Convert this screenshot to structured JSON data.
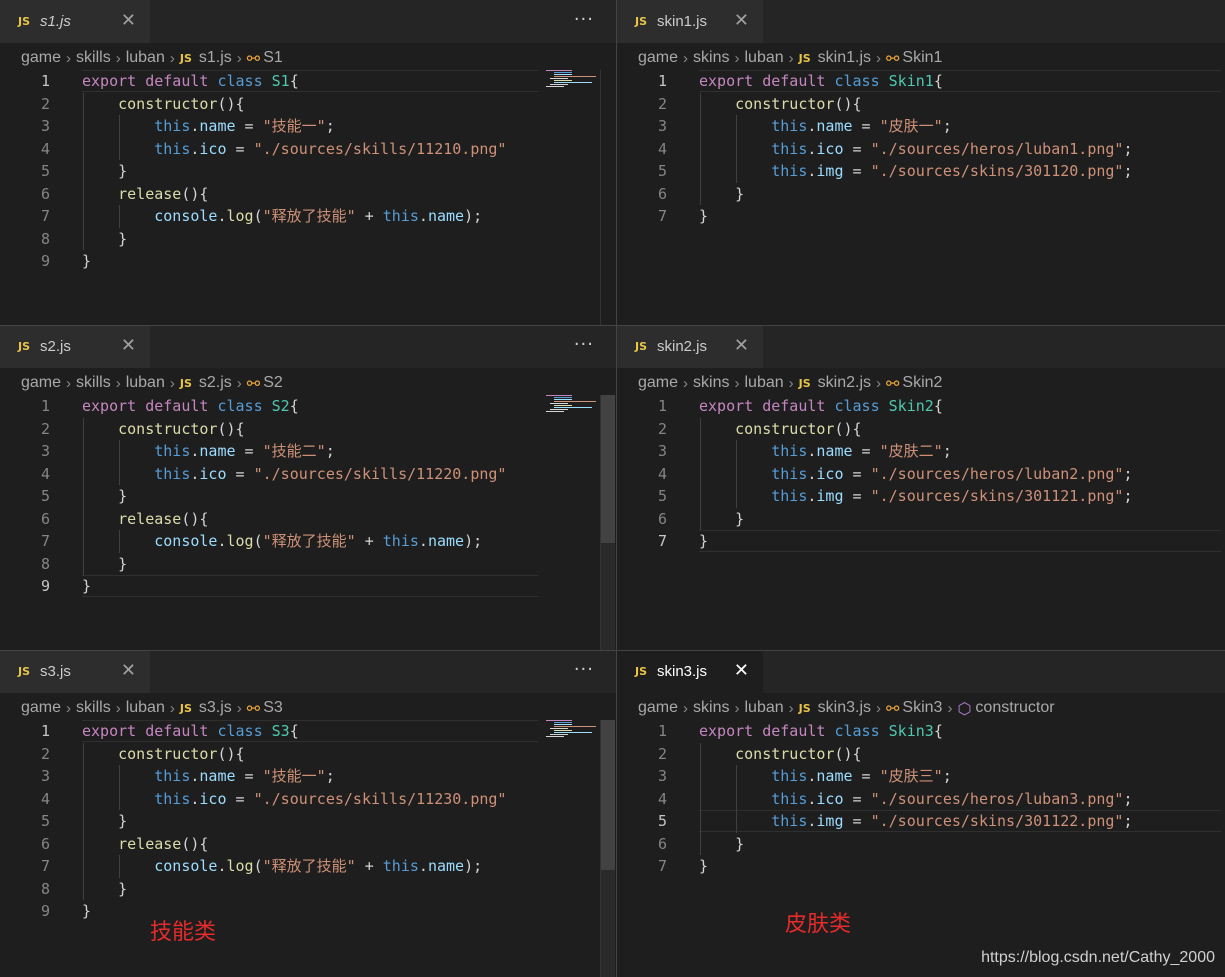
{
  "panes": [
    {
      "id": "s1",
      "tab": {
        "icon": "js-icon",
        "label": "s1.js",
        "italic": true,
        "active": false
      },
      "show_more": true,
      "breadcrumbs": [
        "game",
        "skills",
        "luban",
        "s1.js",
        "S1"
      ],
      "symbol_icon": "class-symbol-icon",
      "current_line": 1,
      "lines": [
        [
          [
            "kw2",
            "export"
          ],
          [
            "pl",
            " "
          ],
          [
            "kw2",
            "default"
          ],
          [
            "pl",
            " "
          ],
          [
            "kw",
            "class"
          ],
          [
            "pl",
            " "
          ],
          [
            "cls",
            "S1"
          ],
          [
            "pl",
            "{"
          ]
        ],
        [
          [
            "pl",
            "    "
          ],
          [
            "fn",
            "constructor"
          ],
          [
            "pl",
            "(){"
          ]
        ],
        [
          [
            "pl",
            "        "
          ],
          [
            "this",
            "this"
          ],
          [
            "pl",
            "."
          ],
          [
            "prop",
            "name"
          ],
          [
            "pl",
            " = "
          ],
          [
            "str",
            "\"技能一\""
          ],
          [
            "pl",
            ";"
          ]
        ],
        [
          [
            "pl",
            "        "
          ],
          [
            "this",
            "this"
          ],
          [
            "pl",
            "."
          ],
          [
            "prop",
            "ico"
          ],
          [
            "pl",
            " = "
          ],
          [
            "str",
            "\"./sources/skills/11210.png\""
          ]
        ],
        [
          [
            "pl",
            "    }"
          ]
        ],
        [
          [
            "pl",
            "    "
          ],
          [
            "fn",
            "release"
          ],
          [
            "pl",
            "(){"
          ]
        ],
        [
          [
            "pl",
            "        "
          ],
          [
            "prop",
            "console"
          ],
          [
            "pl",
            "."
          ],
          [
            "fn",
            "log"
          ],
          [
            "pl",
            "("
          ],
          [
            "str",
            "\"释放了技能\""
          ],
          [
            "pl",
            " + "
          ],
          [
            "this",
            "this"
          ],
          [
            "pl",
            "."
          ],
          [
            "prop",
            "name"
          ],
          [
            "pl",
            ");"
          ]
        ],
        [
          [
            "pl",
            "    }"
          ]
        ],
        [
          [
            "pl",
            "}"
          ]
        ]
      ]
    },
    {
      "id": "skin1",
      "tab": {
        "icon": "js-icon",
        "label": "skin1.js",
        "italic": false,
        "active": false
      },
      "show_more": false,
      "breadcrumbs": [
        "game",
        "skins",
        "luban",
        "skin1.js",
        "Skin1"
      ],
      "symbol_icon": "class-symbol-icon",
      "current_line": 1,
      "lines": [
        [
          [
            "kw2",
            "export"
          ],
          [
            "pl",
            " "
          ],
          [
            "kw2",
            "default"
          ],
          [
            "pl",
            " "
          ],
          [
            "kw",
            "class"
          ],
          [
            "pl",
            " "
          ],
          [
            "cls",
            "Skin1"
          ],
          [
            "pl",
            "{"
          ]
        ],
        [
          [
            "pl",
            "    "
          ],
          [
            "fn",
            "constructor"
          ],
          [
            "pl",
            "(){"
          ]
        ],
        [
          [
            "pl",
            "        "
          ],
          [
            "this",
            "this"
          ],
          [
            "pl",
            "."
          ],
          [
            "prop",
            "name"
          ],
          [
            "pl",
            " = "
          ],
          [
            "str",
            "\"皮肤一\""
          ],
          [
            "pl",
            ";"
          ]
        ],
        [
          [
            "pl",
            "        "
          ],
          [
            "this",
            "this"
          ],
          [
            "pl",
            "."
          ],
          [
            "prop",
            "ico"
          ],
          [
            "pl",
            " = "
          ],
          [
            "str",
            "\"./sources/heros/luban1.png\""
          ],
          [
            "pl",
            ";"
          ]
        ],
        [
          [
            "pl",
            "        "
          ],
          [
            "this",
            "this"
          ],
          [
            "pl",
            "."
          ],
          [
            "prop",
            "img"
          ],
          [
            "pl",
            " = "
          ],
          [
            "str",
            "\"./sources/skins/301120.png\""
          ],
          [
            "pl",
            ";"
          ]
        ],
        [
          [
            "pl",
            "    }"
          ]
        ],
        [
          [
            "pl",
            "}"
          ]
        ]
      ]
    },
    {
      "id": "s2",
      "tab": {
        "icon": "js-icon",
        "label": "s2.js",
        "italic": false,
        "active": false
      },
      "show_more": true,
      "breadcrumbs": [
        "game",
        "skills",
        "luban",
        "s2.js",
        "S2"
      ],
      "symbol_icon": "class-symbol-icon",
      "current_line": 9,
      "lines": [
        [
          [
            "kw2",
            "export"
          ],
          [
            "pl",
            " "
          ],
          [
            "kw2",
            "default"
          ],
          [
            "pl",
            " "
          ],
          [
            "kw",
            "class"
          ],
          [
            "pl",
            " "
          ],
          [
            "cls",
            "S2"
          ],
          [
            "pl",
            "{"
          ]
        ],
        [
          [
            "pl",
            "    "
          ],
          [
            "fn",
            "constructor"
          ],
          [
            "pl",
            "(){"
          ]
        ],
        [
          [
            "pl",
            "        "
          ],
          [
            "this",
            "this"
          ],
          [
            "pl",
            "."
          ],
          [
            "prop",
            "name"
          ],
          [
            "pl",
            " = "
          ],
          [
            "str",
            "\"技能二\""
          ],
          [
            "pl",
            ";"
          ]
        ],
        [
          [
            "pl",
            "        "
          ],
          [
            "this",
            "this"
          ],
          [
            "pl",
            "."
          ],
          [
            "prop",
            "ico"
          ],
          [
            "pl",
            " = "
          ],
          [
            "str",
            "\"./sources/skills/11220.png\""
          ]
        ],
        [
          [
            "pl",
            "    }"
          ]
        ],
        [
          [
            "pl",
            "    "
          ],
          [
            "fn",
            "release"
          ],
          [
            "pl",
            "(){"
          ]
        ],
        [
          [
            "pl",
            "        "
          ],
          [
            "prop",
            "console"
          ],
          [
            "pl",
            "."
          ],
          [
            "fn",
            "log"
          ],
          [
            "pl",
            "("
          ],
          [
            "str",
            "\"释放了技能\""
          ],
          [
            "pl",
            " + "
          ],
          [
            "this",
            "this"
          ],
          [
            "pl",
            "."
          ],
          [
            "prop",
            "name"
          ],
          [
            "pl",
            ");"
          ]
        ],
        [
          [
            "pl",
            "    }"
          ]
        ],
        [
          [
            "pl",
            "}"
          ]
        ]
      ]
    },
    {
      "id": "skin2",
      "tab": {
        "icon": "js-icon",
        "label": "skin2.js",
        "italic": false,
        "active": false
      },
      "show_more": false,
      "breadcrumbs": [
        "game",
        "skins",
        "luban",
        "skin2.js",
        "Skin2"
      ],
      "symbol_icon": "class-symbol-icon",
      "current_line": 7,
      "lines": [
        [
          [
            "kw2",
            "export"
          ],
          [
            "pl",
            " "
          ],
          [
            "kw2",
            "default"
          ],
          [
            "pl",
            " "
          ],
          [
            "kw",
            "class"
          ],
          [
            "pl",
            " "
          ],
          [
            "cls",
            "Skin2"
          ],
          [
            "pl",
            "{"
          ]
        ],
        [
          [
            "pl",
            "    "
          ],
          [
            "fn",
            "constructor"
          ],
          [
            "pl",
            "(){"
          ]
        ],
        [
          [
            "pl",
            "        "
          ],
          [
            "this",
            "this"
          ],
          [
            "pl",
            "."
          ],
          [
            "prop",
            "name"
          ],
          [
            "pl",
            " = "
          ],
          [
            "str",
            "\"皮肤二\""
          ],
          [
            "pl",
            ";"
          ]
        ],
        [
          [
            "pl",
            "        "
          ],
          [
            "this",
            "this"
          ],
          [
            "pl",
            "."
          ],
          [
            "prop",
            "ico"
          ],
          [
            "pl",
            " = "
          ],
          [
            "str",
            "\"./sources/heros/luban2.png\""
          ],
          [
            "pl",
            ";"
          ]
        ],
        [
          [
            "pl",
            "        "
          ],
          [
            "this",
            "this"
          ],
          [
            "pl",
            "."
          ],
          [
            "prop",
            "img"
          ],
          [
            "pl",
            " = "
          ],
          [
            "str",
            "\"./sources/skins/301121.png\""
          ],
          [
            "pl",
            ";"
          ]
        ],
        [
          [
            "pl",
            "    }"
          ]
        ],
        [
          [
            "pl",
            "}"
          ]
        ]
      ]
    },
    {
      "id": "s3",
      "tab": {
        "icon": "js-icon",
        "label": "s3.js",
        "italic": false,
        "active": false
      },
      "show_more": true,
      "breadcrumbs": [
        "game",
        "skills",
        "luban",
        "s3.js",
        "S3"
      ],
      "symbol_icon": "class-symbol-icon",
      "current_line": 1,
      "lines": [
        [
          [
            "kw2",
            "export"
          ],
          [
            "pl",
            " "
          ],
          [
            "kw2",
            "default"
          ],
          [
            "pl",
            " "
          ],
          [
            "kw",
            "class"
          ],
          [
            "pl",
            " "
          ],
          [
            "cls",
            "S3"
          ],
          [
            "pl",
            "{"
          ]
        ],
        [
          [
            "pl",
            "    "
          ],
          [
            "fn",
            "constructor"
          ],
          [
            "pl",
            "(){"
          ]
        ],
        [
          [
            "pl",
            "        "
          ],
          [
            "this",
            "this"
          ],
          [
            "pl",
            "."
          ],
          [
            "prop",
            "name"
          ],
          [
            "pl",
            " = "
          ],
          [
            "str",
            "\"技能一\""
          ],
          [
            "pl",
            ";"
          ]
        ],
        [
          [
            "pl",
            "        "
          ],
          [
            "this",
            "this"
          ],
          [
            "pl",
            "."
          ],
          [
            "prop",
            "ico"
          ],
          [
            "pl",
            " = "
          ],
          [
            "str",
            "\"./sources/skills/11230.png\""
          ]
        ],
        [
          [
            "pl",
            "    }"
          ]
        ],
        [
          [
            "pl",
            "    "
          ],
          [
            "fn",
            "release"
          ],
          [
            "pl",
            "(){"
          ]
        ],
        [
          [
            "pl",
            "        "
          ],
          [
            "prop",
            "console"
          ],
          [
            "pl",
            "."
          ],
          [
            "fn",
            "log"
          ],
          [
            "pl",
            "("
          ],
          [
            "str",
            "\"释放了技能\""
          ],
          [
            "pl",
            " + "
          ],
          [
            "this",
            "this"
          ],
          [
            "pl",
            "."
          ],
          [
            "prop",
            "name"
          ],
          [
            "pl",
            ");"
          ]
        ],
        [
          [
            "pl",
            "    }"
          ]
        ],
        [
          [
            "pl",
            "}"
          ]
        ]
      ]
    },
    {
      "id": "skin3",
      "tab": {
        "icon": "js-icon",
        "label": "skin3.js",
        "italic": false,
        "active": true
      },
      "show_more": false,
      "breadcrumbs": [
        "game",
        "skins",
        "luban",
        "skin3.js",
        "Skin3",
        "constructor"
      ],
      "symbol_icon": "class-symbol-icon",
      "method_icon": "method-cube-icon",
      "current_line": 5,
      "lines": [
        [
          [
            "kw2",
            "export"
          ],
          [
            "pl",
            " "
          ],
          [
            "kw2",
            "default"
          ],
          [
            "pl",
            " "
          ],
          [
            "kw",
            "class"
          ],
          [
            "pl",
            " "
          ],
          [
            "cls",
            "Skin3"
          ],
          [
            "pl",
            "{"
          ]
        ],
        [
          [
            "pl",
            "    "
          ],
          [
            "fn",
            "constructor"
          ],
          [
            "pl",
            "(){"
          ]
        ],
        [
          [
            "pl",
            "        "
          ],
          [
            "this",
            "this"
          ],
          [
            "pl",
            "."
          ],
          [
            "prop",
            "name"
          ],
          [
            "pl",
            " = "
          ],
          [
            "str",
            "\"皮肤三\""
          ],
          [
            "pl",
            ";"
          ]
        ],
        [
          [
            "pl",
            "        "
          ],
          [
            "this",
            "this"
          ],
          [
            "pl",
            "."
          ],
          [
            "prop",
            "ico"
          ],
          [
            "pl",
            " = "
          ],
          [
            "str",
            "\"./sources/heros/luban3.png\""
          ],
          [
            "pl",
            ";"
          ]
        ],
        [
          [
            "pl",
            "        "
          ],
          [
            "this",
            "this"
          ],
          [
            "pl",
            "."
          ],
          [
            "prop",
            "img"
          ],
          [
            "pl",
            " = "
          ],
          [
            "str",
            "\"./sources/skins/301122.png\""
          ],
          [
            "pl",
            ";"
          ]
        ],
        [
          [
            "pl",
            "    }"
          ]
        ],
        [
          [
            "pl",
            "}"
          ]
        ]
      ]
    }
  ],
  "annotations": {
    "skills_label": "技能类",
    "skins_label": "皮肤类"
  },
  "watermark": "https://blog.csdn.net/Cathy_2000",
  "colors": {
    "background": "#1e1e1e",
    "tabbar": "#252526",
    "keyword": "#569cd6",
    "export_keyword": "#c586c0",
    "class_name": "#4ec9b0",
    "function": "#dcdcaa",
    "property": "#9cdcfe",
    "string": "#ce9178",
    "annotation": "#e52b2b",
    "js_icon": "#e8c547"
  }
}
